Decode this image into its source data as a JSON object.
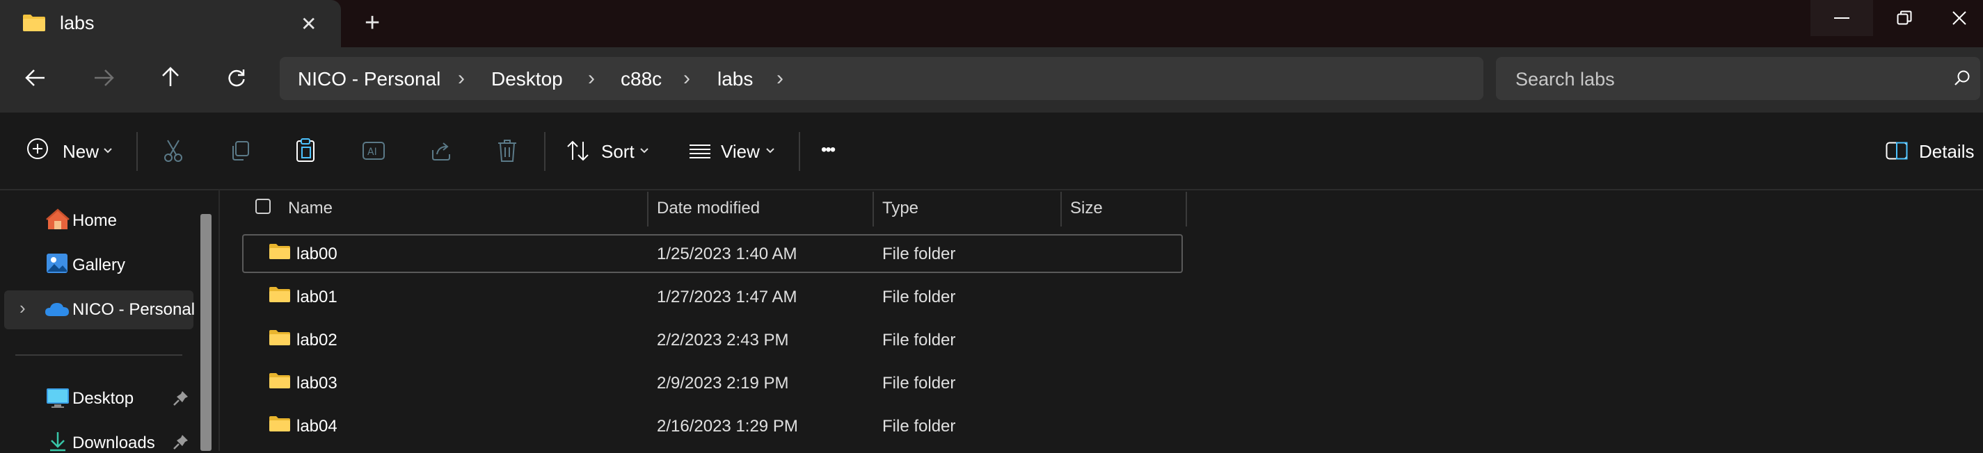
{
  "window": {
    "tab_title": "labs",
    "new_tab_glyph": "+",
    "close_tab_glyph": "✕"
  },
  "nav": {
    "breadcrumbs": [
      "NICO - Personal",
      "Desktop",
      "c88c",
      "labs"
    ],
    "separator_glyph": "›",
    "search_placeholder": "Search labs"
  },
  "toolbar": {
    "new_label": "New",
    "sort_label": "Sort",
    "view_label": "View",
    "more_glyph": "•••",
    "details_label": "Details"
  },
  "sidebar": {
    "items": [
      {
        "label": "Home",
        "icon": "home-icon"
      },
      {
        "label": "Gallery",
        "icon": "gallery-icon"
      },
      {
        "label": "NICO - Personal",
        "icon": "onedrive-cloud-icon"
      }
    ],
    "pinned": [
      {
        "label": "Desktop",
        "icon": "desktop-icon"
      },
      {
        "label": "Downloads",
        "icon": "downloads-icon"
      }
    ],
    "expand_glyph": "›"
  },
  "filelist": {
    "columns": [
      "Name",
      "Date modified",
      "Type",
      "Size"
    ],
    "rows": [
      {
        "name": "lab00",
        "date": "1/25/2023 1:40 AM",
        "type": "File folder",
        "size": ""
      },
      {
        "name": "lab01",
        "date": "1/27/2023 1:47 AM",
        "type": "File folder",
        "size": ""
      },
      {
        "name": "lab02",
        "date": "2/2/2023 2:43 PM",
        "type": "File folder",
        "size": ""
      },
      {
        "name": "lab03",
        "date": "2/9/2023 2:19 PM",
        "type": "File folder",
        "size": ""
      },
      {
        "name": "lab04",
        "date": "2/16/2023 1:29 PM",
        "type": "File folder",
        "size": ""
      }
    ]
  },
  "colors": {
    "folder": "#f3c33f",
    "accent": "#4cc2ff",
    "background": "#191919",
    "titlebar": "#1b0f10"
  }
}
